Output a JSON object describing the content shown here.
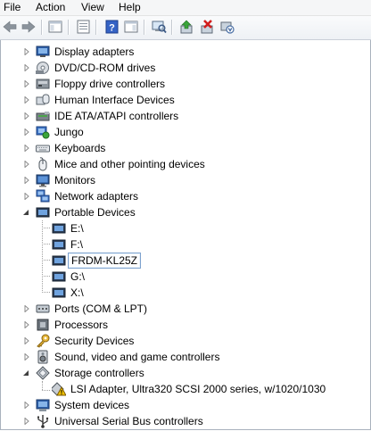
{
  "menu": {
    "file": "File",
    "action": "Action",
    "view": "View",
    "help": "Help"
  },
  "toolbar_icons": [
    "back-arrow-icon",
    "forward-arrow-icon",
    "show-hide-console-tree-icon",
    "properties-icon",
    "help-icon",
    "show-action-pane-icon",
    "scan-hardware-icon",
    "update-driver-icon",
    "uninstall-icon",
    "disable-device-icon"
  ],
  "tree": {
    "display_adapters": "Display adapters",
    "dvd_cdrom": "DVD/CD-ROM drives",
    "floppy_controllers": "Floppy drive controllers",
    "hid": "Human Interface Devices",
    "ide": "IDE ATA/ATAPI controllers",
    "jungo": "Jungo",
    "keyboards": "Keyboards",
    "mice": "Mice and other pointing devices",
    "monitors": "Monitors",
    "network": "Network adapters",
    "portable": "Portable Devices",
    "portable_children": [
      "E:\\",
      "F:\\",
      "FRDM-KL25Z",
      "G:\\",
      "X:\\"
    ],
    "ports": "Ports (COM & LPT)",
    "processors": "Processors",
    "security": "Security Devices",
    "sound": "Sound, video and game controllers",
    "storage": "Storage controllers",
    "storage_child": "LSI Adapter, Ultra320 SCSI 2000 series, w/1020/1030",
    "system": "System devices",
    "usb": "Universal Serial Bus controllers"
  },
  "colors": {
    "selection_border": "#7da2ce",
    "warning": "#f2c200"
  }
}
